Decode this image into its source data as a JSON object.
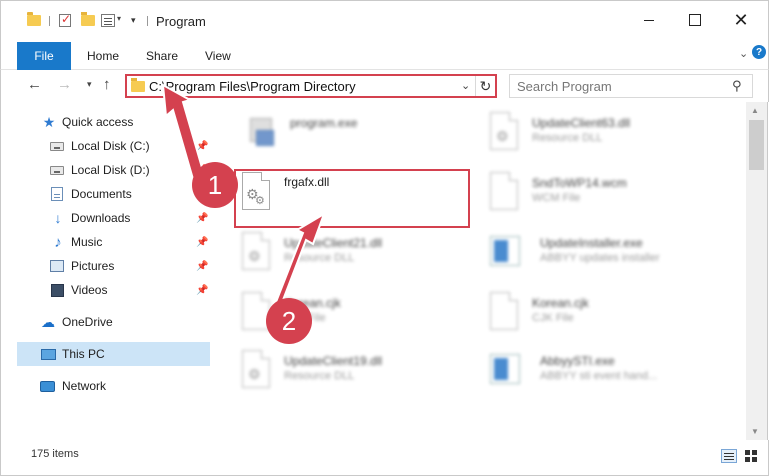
{
  "window": {
    "title": "Program",
    "close_glyph": "✕"
  },
  "ribbon": {
    "file_tab": "File",
    "tabs": [
      "Home",
      "Share",
      "View"
    ]
  },
  "address": {
    "path": "C:\\Program Files\\Program Directory",
    "highlight_color": "#d4414f"
  },
  "search": {
    "placeholder": "Search Program"
  },
  "nav": {
    "items": [
      {
        "label": "Quick access",
        "icon": "star-icon"
      },
      {
        "label": "Local Disk (C:)",
        "icon": "drive-icon",
        "pinned": true
      },
      {
        "label": "Local Disk (D:)",
        "icon": "drive-icon",
        "pinned": true
      },
      {
        "label": "Documents",
        "icon": "documents-icon",
        "pinned": true
      },
      {
        "label": "Downloads",
        "icon": "download-icon",
        "pinned": true
      },
      {
        "label": "Music",
        "icon": "music-icon",
        "pinned": true
      },
      {
        "label": "Pictures",
        "icon": "pictures-icon",
        "pinned": true
      },
      {
        "label": "Videos",
        "icon": "videos-icon",
        "pinned": true
      },
      {
        "label": "OneDrive",
        "icon": "cloud-icon"
      },
      {
        "label": "This PC",
        "icon": "computer-icon",
        "selected": true
      },
      {
        "label": "Network",
        "icon": "network-icon"
      }
    ]
  },
  "files": [
    {
      "name": "program.exe",
      "desc": "",
      "icon": "exe-icon"
    },
    {
      "name": "UpdateClient63.dll",
      "desc": "Resource DLL",
      "icon": "dll-icon"
    },
    {
      "name": "frgafx.dll",
      "desc": "",
      "icon": "dll-gear-icon",
      "highlighted": true
    },
    {
      "name": "SndToWP14.wcm",
      "desc": "WCM File",
      "icon": "file-icon"
    },
    {
      "name": "UpdateClient21.dll",
      "desc": "Resource DLL",
      "icon": "dll-icon"
    },
    {
      "name": "UpdateInstaller.exe",
      "desc": "ABBYY updates installer",
      "icon": "installer-icon"
    },
    {
      "name": "Korean.cjk",
      "desc": "CJK File",
      "icon": "file-icon"
    },
    {
      "name": "Korean.cjk",
      "desc": "CJK File",
      "icon": "file-icon"
    },
    {
      "name": "UpdateClient19.dll",
      "desc": "Resource DLL",
      "icon": "dll-icon"
    },
    {
      "name": "AbbyySTI.exe",
      "desc": "ABBYY sti event hand...",
      "icon": "installer-icon"
    }
  ],
  "status": {
    "item_count": "175 items"
  },
  "callouts": {
    "step1": "1",
    "step2": "2",
    "color": "#d4414f"
  }
}
